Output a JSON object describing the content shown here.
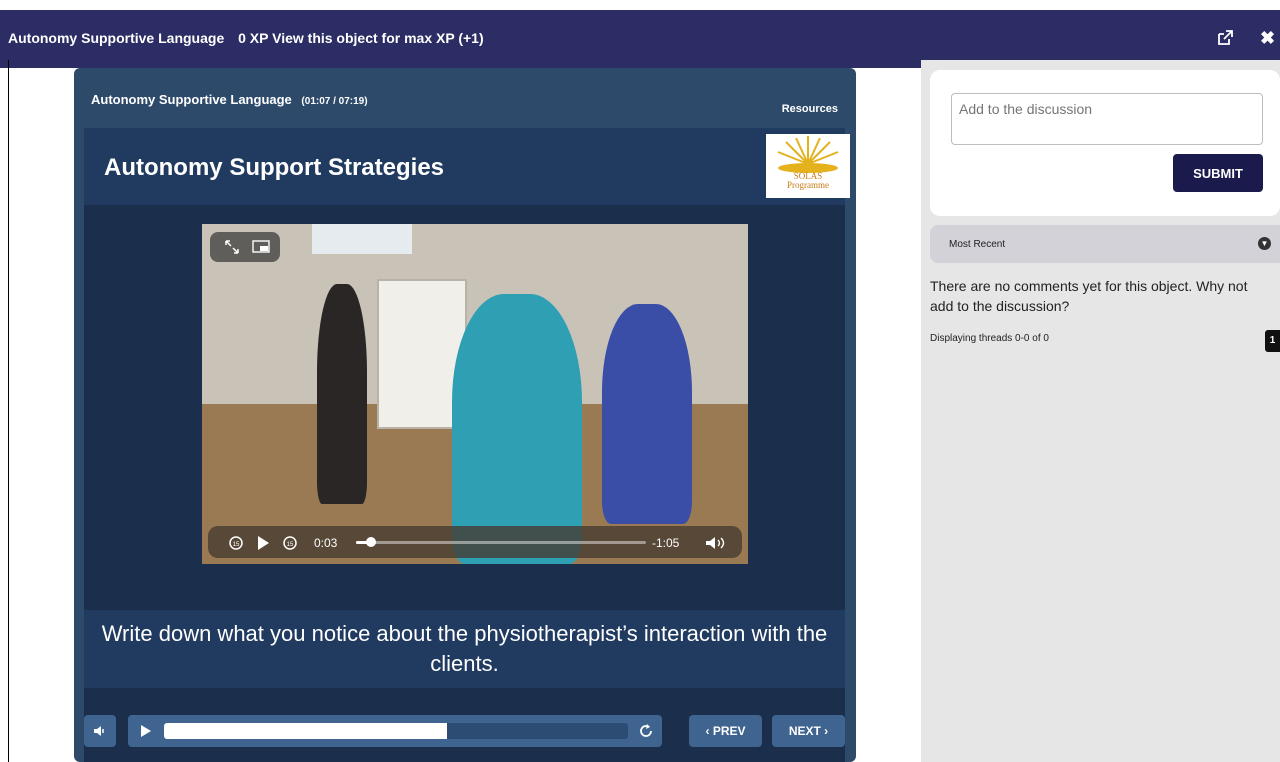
{
  "topbar": {
    "title": "Autonomy Supportive Language",
    "xp_text": "0 XP View this object for max XP (+1)",
    "icons": [
      "external-link-icon",
      "close-icon"
    ],
    "close_glyph": "✖"
  },
  "player": {
    "title": "Autonomy Supportive Language",
    "time": "(01:07 / 07:19)",
    "resources_label": "Resources",
    "slide": {
      "heading": "Autonomy Support Strategies",
      "logo_text_1": "SOLAS",
      "logo_text_2": "Programme",
      "caption": "Write down what you notice about the physiotherapist’s interaction with the clients."
    },
    "video": {
      "elapsed": "0:03",
      "remaining": "-1:05",
      "progress": 0.05
    },
    "controls": {
      "seek_progress": 0.61,
      "prev_label": "‹ PREV",
      "next_label": "NEXT ›"
    }
  },
  "discussion": {
    "placeholder": "Add to the discussion",
    "submit_label": "SUBMIT",
    "sort_label": "Most Recent",
    "empty_text": "There are no comments yet for this object. Why not add to the discussion?",
    "threads_text": "Displaying threads 0-0 of 0",
    "page": "1"
  },
  "colors": {
    "topbar": "#2b2d64",
    "player": "#2d4a6b",
    "submit": "#1a1a4d"
  }
}
